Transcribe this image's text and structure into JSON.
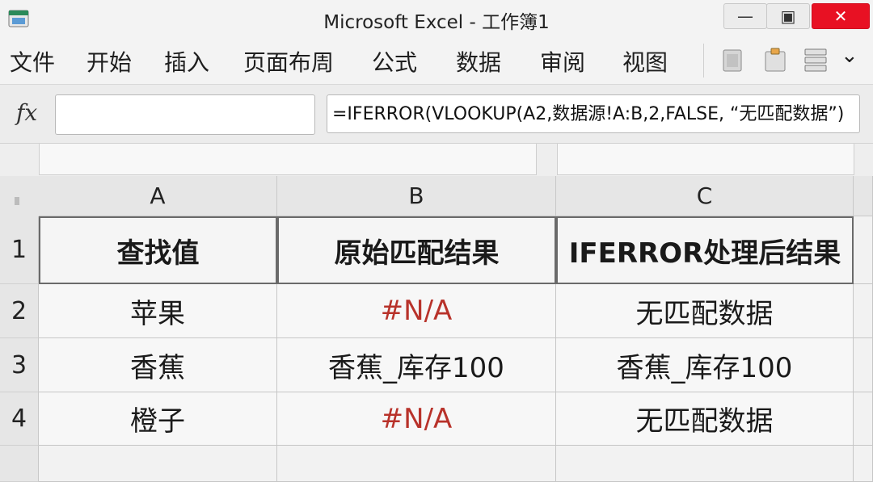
{
  "window": {
    "title": "Microsoft Excel - 工作簿1",
    "controls": {
      "minimize": "—",
      "maximize": "▣",
      "close": "✕"
    }
  },
  "menu": {
    "items": [
      "文件",
      "开始",
      "插入",
      "页面布周",
      "公式",
      "数据",
      "审阅",
      "视图"
    ],
    "more": "⌄"
  },
  "formula_bar": {
    "fx_label": "fx",
    "name_box": "",
    "formula": "=IFERROR(VLOOKUP(A2,数据源!A:B,2,FALSE, “无匹配数据”)"
  },
  "sheet": {
    "columns": [
      "A",
      "B",
      "C"
    ],
    "rows": [
      "1",
      "2",
      "3",
      "4"
    ],
    "cells": [
      [
        "查找值",
        "原始匹配结果",
        "IFERROR处理后结果"
      ],
      [
        "苹果",
        "#N/A",
        "无匹配数据"
      ],
      [
        "香蕉",
        "香蕉_库存100",
        "香蕉_库存100"
      ],
      [
        "橙子",
        "#N/A",
        "无匹配数据"
      ]
    ],
    "error_color": "#b8322a"
  }
}
